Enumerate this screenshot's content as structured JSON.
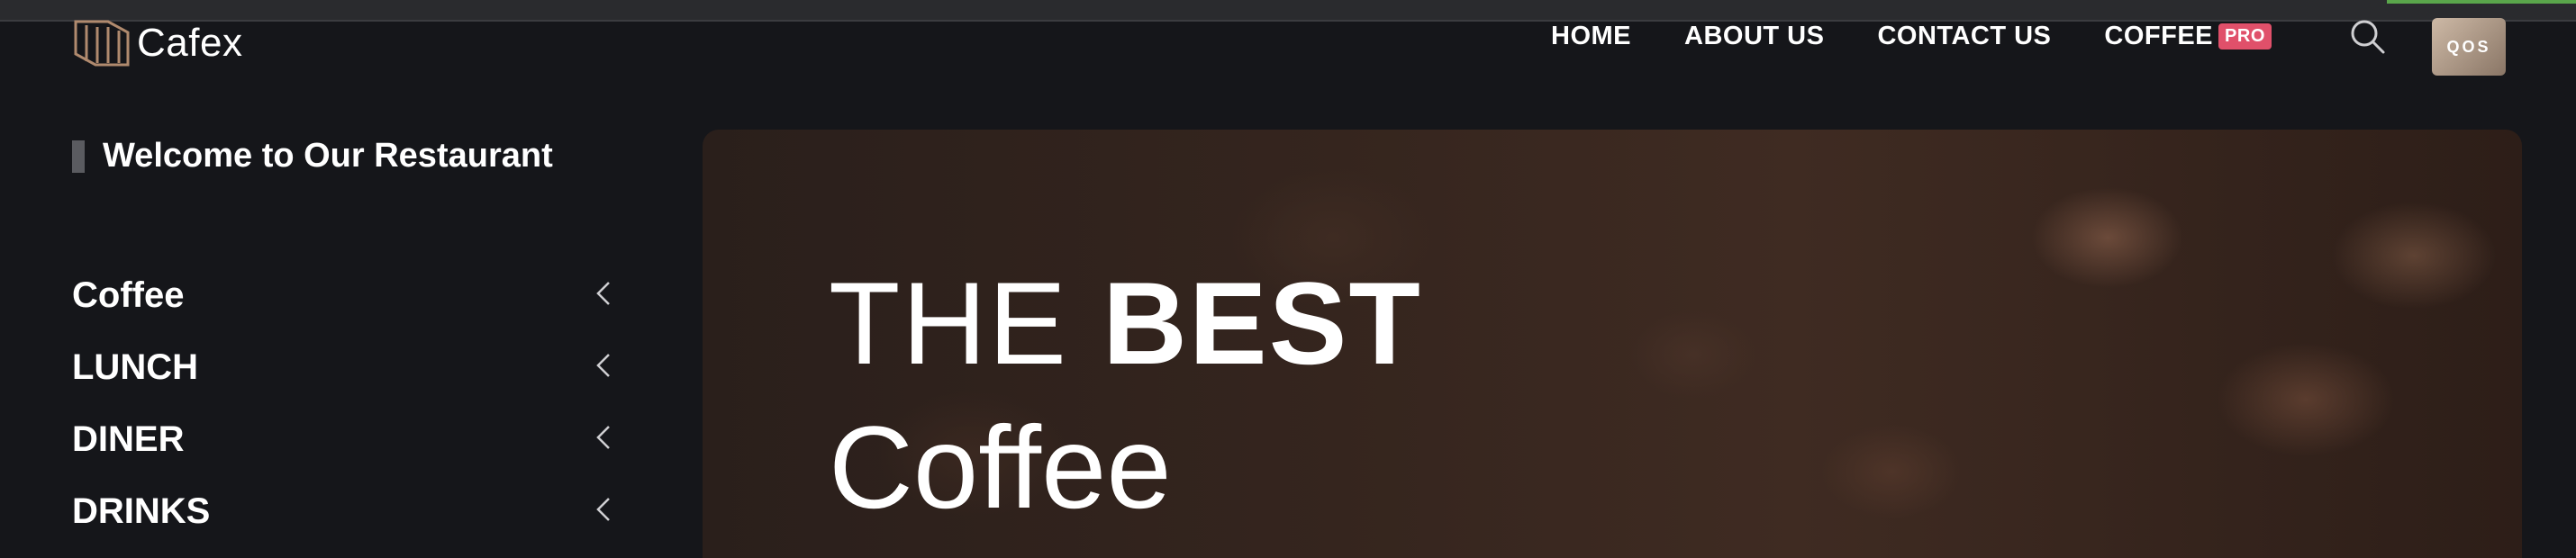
{
  "brand": {
    "name": "Cafex"
  },
  "nav": {
    "items": [
      {
        "label": "HOME"
      },
      {
        "label": "ABOUT US"
      },
      {
        "label": "CONTACT US"
      },
      {
        "label": "COFFEE",
        "badge": "PRO"
      }
    ]
  },
  "header": {
    "avatar_text": "QOS"
  },
  "sidebar": {
    "welcome": "Welcome to Our Restaurant",
    "items": [
      {
        "label": "Coffee"
      },
      {
        "label": "LUNCH"
      },
      {
        "label": "DINER"
      },
      {
        "label": "DRINKS"
      }
    ]
  },
  "hero": {
    "line1_light": "THE",
    "line1_bold": "BEST",
    "line2": "Coffee"
  },
  "icons": {
    "logo": "cafex-logo-icon",
    "search": "search-icon",
    "chevron": "chevron-left-icon"
  },
  "colors": {
    "background": "#15161a",
    "pro_badge": "#e0506a",
    "logo_accent": "#b08a6e"
  }
}
